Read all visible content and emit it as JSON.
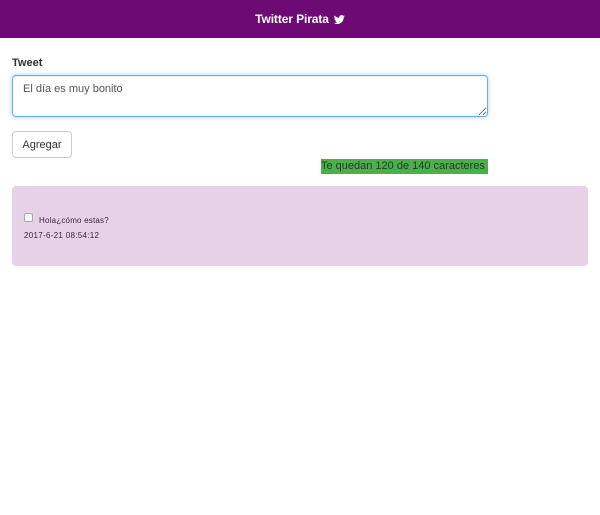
{
  "navbar": {
    "title": "Twitter Pirata",
    "icon": "twitter-bird-icon",
    "background": "#6d0a74"
  },
  "form": {
    "label": "Tweet",
    "input_value": "El día es muy bonito",
    "add_button_label": "Agregar",
    "counter_text": "Te quedan 120 de 140 caracteres",
    "counter_color": "#4cae4c"
  },
  "tweets": [
    {
      "text": "Hola¿cómo estas?",
      "date": "2017-6-21 08:54:12",
      "checked": false
    }
  ],
  "tweet_list_background": "#e6d1e7"
}
